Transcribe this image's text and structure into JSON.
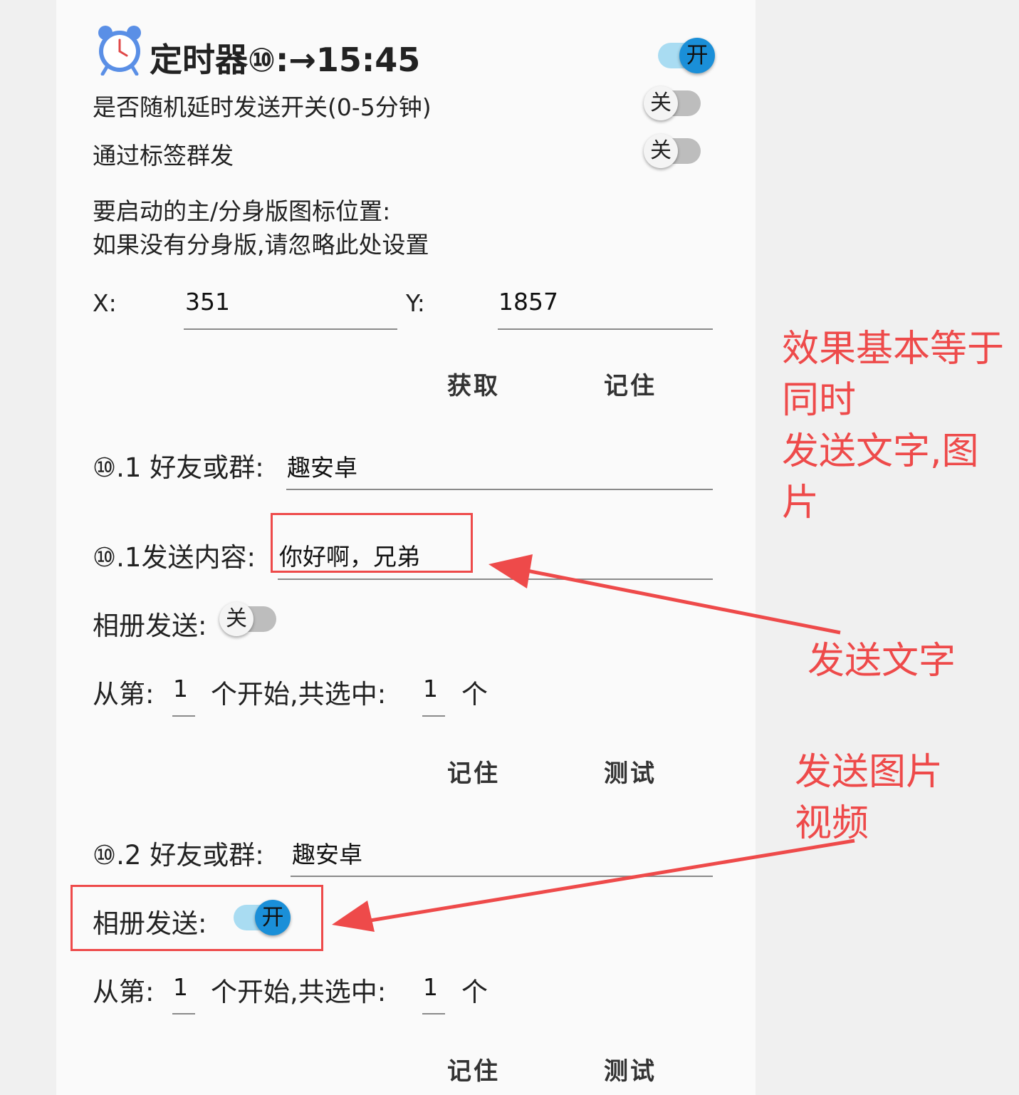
{
  "timer": {
    "title": "定时器⑩:→15:45",
    "main_switch": "开",
    "random_delay_label": "是否随机延时发送开关(0-5分钟)",
    "random_delay_switch": "关",
    "tag_group_label": "通过标签群发",
    "tag_group_switch": "关",
    "icon_pos_line1": "要启动的主/分身版图标位置:",
    "icon_pos_line2": "如果没有分身版,请忽略此处设置",
    "x_label": "X:",
    "x_value": "351",
    "y_label": "Y:",
    "y_value": "1857",
    "get_button": "获取",
    "remember_button": "记住"
  },
  "section1": {
    "friend_label": "⑩.1 好友或群:",
    "friend_value": "趣安卓",
    "content_label": "⑩.1发送内容:",
    "content_value": "你好啊，兄弟",
    "album_label": "相册发送:",
    "album_switch": "关",
    "from_label": "从第:",
    "from_value": "1",
    "mid_label": "个开始,共选中:",
    "count_value": "1",
    "unit": "个",
    "remember_button": "记住",
    "test_button": "测试"
  },
  "section2": {
    "friend_label": "⑩.2 好友或群:",
    "friend_value": "趣安卓",
    "album_label": "相册发送:",
    "album_switch": "开",
    "from_label": "从第:",
    "from_value": "1",
    "mid_label": "个开始,共选中:",
    "count_value": "1",
    "unit": "个",
    "remember_button": "记住",
    "test_button": "测试"
  },
  "annotations": {
    "effect_lines": [
      "效果基本等于",
      "同时",
      "发送文字,图",
      "片"
    ],
    "send_text": "发送文字",
    "send_media_lines": [
      "发送图片",
      "视频"
    ]
  },
  "colors": {
    "annotation_red": "#ee4a4a",
    "switch_on_knob": "#1a8fd8",
    "switch_on_track": "#a9dcf2",
    "switch_off_track": "#bdbdbd"
  },
  "icons": {
    "timer": "alarm-clock-icon"
  }
}
